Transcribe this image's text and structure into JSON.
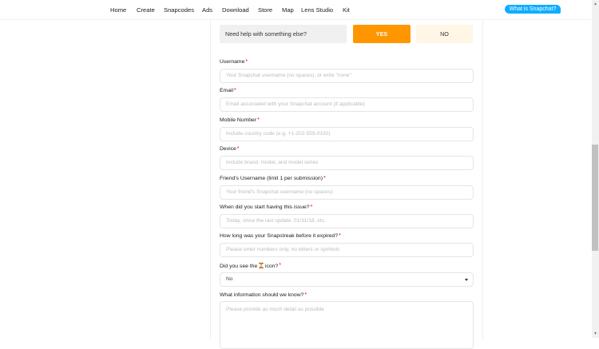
{
  "nav": {
    "items": [
      "Home",
      "Create",
      "Snapcodes",
      "Ads",
      "Download",
      "Store",
      "Map",
      "Lens Studio",
      "Kit"
    ],
    "cta": "What is Snapchat?"
  },
  "help_row": {
    "question": "Need help with something else?",
    "yes": "YES",
    "no": "NO"
  },
  "form": {
    "required_mark": "*",
    "fields": [
      {
        "label": "Username",
        "placeholder": "Your Snapchat username (no spaces), or write \"none\""
      },
      {
        "label": "Email",
        "placeholder": "Email associated with your Snapchat account (if applicable)"
      },
      {
        "label": "Mobile Number",
        "placeholder": "Include country code (e.g. +1-202-555-0192)"
      },
      {
        "label": "Device",
        "placeholder": "Include brand, model, and model series"
      },
      {
        "label": "Friend's Username (limit 1 per submission)",
        "placeholder": "Your friend's Snapchat username (no spaces)"
      },
      {
        "label": "When did you start having this issue?",
        "placeholder": "Today, since the last update, 01/31/18, etc."
      },
      {
        "label": "How long was your Snapstreak before it expired?",
        "placeholder": "Please enter numbers only, no letters or symbols"
      }
    ],
    "hourglass": {
      "label_before": "Did you see the",
      "label_after": "icon?",
      "value": "No",
      "icon": "hourglass-icon"
    },
    "info": {
      "label": "What information should we know?",
      "placeholder": "Please provide as much detail as possible"
    }
  },
  "colors": {
    "accent": "#ff9600",
    "cta": "#0eadff",
    "required": "#e1001a"
  }
}
